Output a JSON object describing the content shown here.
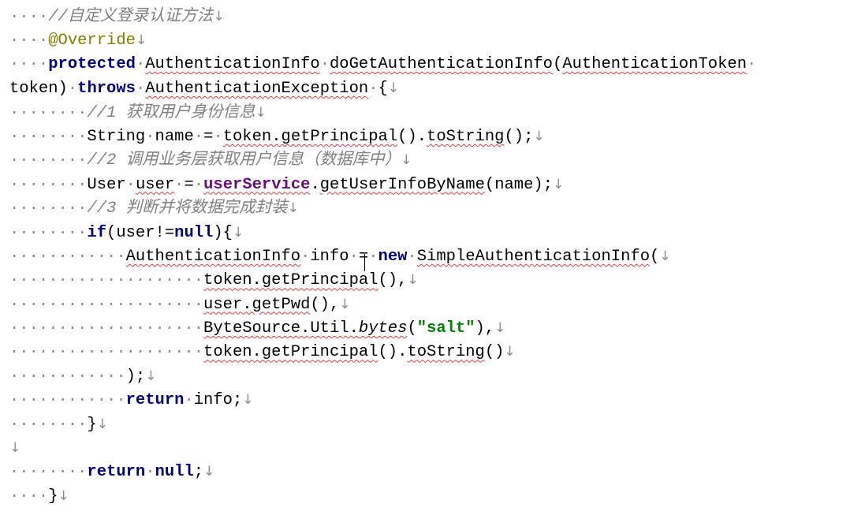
{
  "code": {
    "lines": [
      [
        {
          "t": "····",
          "c": "dot"
        },
        {
          "t": "//自定义登录认证方法",
          "c": "cm"
        },
        {
          "t": "↓",
          "c": "mark"
        }
      ],
      [
        {
          "t": "····",
          "c": "dot"
        },
        {
          "t": "@Override",
          "c": "ann"
        },
        {
          "t": "↓",
          "c": "mark"
        }
      ],
      [
        {
          "t": "····",
          "c": "dot"
        },
        {
          "t": "protected",
          "c": "kw"
        },
        {
          "t": "·",
          "c": "dot"
        },
        {
          "t": "AuthenticationInfo",
          "c": "ul"
        },
        {
          "t": "·",
          "c": "dot"
        },
        {
          "t": "doGetAuthenticationInfo",
          "c": "ul"
        },
        {
          "t": "(",
          "c": ""
        },
        {
          "t": "AuthenticationToken",
          "c": "ul"
        },
        {
          "t": "·",
          "c": "dot"
        }
      ],
      [
        {
          "t": "token",
          "c": ""
        },
        {
          "t": ")",
          "c": ""
        },
        {
          "t": "·",
          "c": "dot"
        },
        {
          "t": "throws",
          "c": "kw"
        },
        {
          "t": "·",
          "c": "dot"
        },
        {
          "t": "AuthenticationException",
          "c": "ul"
        },
        {
          "t": "·",
          "c": "dot"
        },
        {
          "t": "{",
          "c": ""
        },
        {
          "t": "↓",
          "c": "mark"
        }
      ],
      [
        {
          "t": "········",
          "c": "dot"
        },
        {
          "t": "//1 获取用户身份信息",
          "c": "cm"
        },
        {
          "t": "↓",
          "c": "mark"
        }
      ],
      [
        {
          "t": "········",
          "c": "dot"
        },
        {
          "t": "String",
          "c": ""
        },
        {
          "t": "·",
          "c": "dot"
        },
        {
          "t": "name",
          "c": ""
        },
        {
          "t": "·",
          "c": "dot"
        },
        {
          "t": "=",
          "c": ""
        },
        {
          "t": "·",
          "c": "dot"
        },
        {
          "t": "token.getPrincipal",
          "c": "ul"
        },
        {
          "t": "().",
          "c": ""
        },
        {
          "t": "toString",
          "c": "ul"
        },
        {
          "t": "();",
          "c": ""
        },
        {
          "t": "↓",
          "c": "mark"
        }
      ],
      [
        {
          "t": "········",
          "c": "dot"
        },
        {
          "t": "//2 调用业务层获取用户信息（数据库中）",
          "c": "cm"
        },
        {
          "t": "↓",
          "c": "mark"
        }
      ],
      [
        {
          "t": "········",
          "c": "dot"
        },
        {
          "t": "User",
          "c": ""
        },
        {
          "t": "·",
          "c": "dot"
        },
        {
          "t": "user",
          "c": "ul"
        },
        {
          "t": "·",
          "c": "dot"
        },
        {
          "t": "=",
          "c": ""
        },
        {
          "t": "·",
          "c": "dot"
        },
        {
          "t": "userService",
          "c": "fld ul"
        },
        {
          "t": ".",
          "c": ""
        },
        {
          "t": "getUserInfoByName",
          "c": "ul"
        },
        {
          "t": "(name);",
          "c": ""
        },
        {
          "t": "↓",
          "c": "mark"
        }
      ],
      [
        {
          "t": "········",
          "c": "dot"
        },
        {
          "t": "//3 判断并将数据完成封装",
          "c": "cm"
        },
        {
          "t": "↓",
          "c": "mark"
        }
      ],
      [
        {
          "t": "········",
          "c": "dot"
        },
        {
          "t": "if",
          "c": "kw"
        },
        {
          "t": "(user!=",
          "c": ""
        },
        {
          "t": "null",
          "c": "kw"
        },
        {
          "t": "){",
          "c": ""
        },
        {
          "t": "↓",
          "c": "mark"
        }
      ],
      [
        {
          "t": "············",
          "c": "dot"
        },
        {
          "t": "AuthenticationInfo",
          "c": "ul"
        },
        {
          "t": "·",
          "c": "dot"
        },
        {
          "t": "info",
          "c": ""
        },
        {
          "t": "·",
          "c": "dot"
        },
        {
          "t": "=",
          "c": ""
        },
        {
          "t": "·",
          "c": "dot"
        },
        {
          "t": "new",
          "c": "kw"
        },
        {
          "t": "·",
          "c": "dot"
        },
        {
          "t": "SimpleAuthenticationInfo",
          "c": "ul"
        },
        {
          "t": "(",
          "c": ""
        },
        {
          "t": "↓",
          "c": "mark"
        }
      ],
      [
        {
          "t": "····················",
          "c": "dot"
        },
        {
          "t": "token.getPrincipal",
          "c": "ul"
        },
        {
          "t": "(),",
          "c": ""
        },
        {
          "t": "↓",
          "c": "mark"
        }
      ],
      [
        {
          "t": "····················",
          "c": "dot"
        },
        {
          "t": "user.getPwd",
          "c": "ul"
        },
        {
          "t": "(),",
          "c": ""
        },
        {
          "t": "↓",
          "c": "mark"
        }
      ],
      [
        {
          "t": "····················",
          "c": "dot"
        },
        {
          "t": "ByteSource.Util.",
          "c": "ul"
        },
        {
          "t": "bytes",
          "c": "it ul"
        },
        {
          "t": "(",
          "c": ""
        },
        {
          "t": "\"salt\"",
          "c": "str"
        },
        {
          "t": "),",
          "c": ""
        },
        {
          "t": "↓",
          "c": "mark"
        }
      ],
      [
        {
          "t": "····················",
          "c": "dot"
        },
        {
          "t": "token.getPrincipal",
          "c": "ul"
        },
        {
          "t": "().",
          "c": ""
        },
        {
          "t": "toString",
          "c": "ul"
        },
        {
          "t": "()",
          "c": ""
        },
        {
          "t": "↓",
          "c": "mark"
        }
      ],
      [
        {
          "t": "············",
          "c": "dot"
        },
        {
          "t": ");",
          "c": ""
        },
        {
          "t": "↓",
          "c": "mark"
        }
      ],
      [
        {
          "t": "············",
          "c": "dot"
        },
        {
          "t": "return",
          "c": "kw"
        },
        {
          "t": "·",
          "c": "dot"
        },
        {
          "t": "info;",
          "c": ""
        },
        {
          "t": "↓",
          "c": "mark"
        }
      ],
      [
        {
          "t": "········",
          "c": "dot"
        },
        {
          "t": "}",
          "c": ""
        },
        {
          "t": "↓",
          "c": "mark"
        }
      ],
      [
        {
          "t": "↓",
          "c": "mark"
        }
      ],
      [
        {
          "t": "········",
          "c": "dot"
        },
        {
          "t": "return",
          "c": "kw"
        },
        {
          "t": "·",
          "c": "dot"
        },
        {
          "t": "null",
          "c": "kw"
        },
        {
          "t": ";",
          "c": ""
        },
        {
          "t": "↓",
          "c": "mark"
        }
      ],
      [
        {
          "t": "····",
          "c": "dot"
        },
        {
          "t": "}",
          "c": ""
        },
        {
          "t": "↓",
          "c": "mark"
        }
      ]
    ]
  }
}
